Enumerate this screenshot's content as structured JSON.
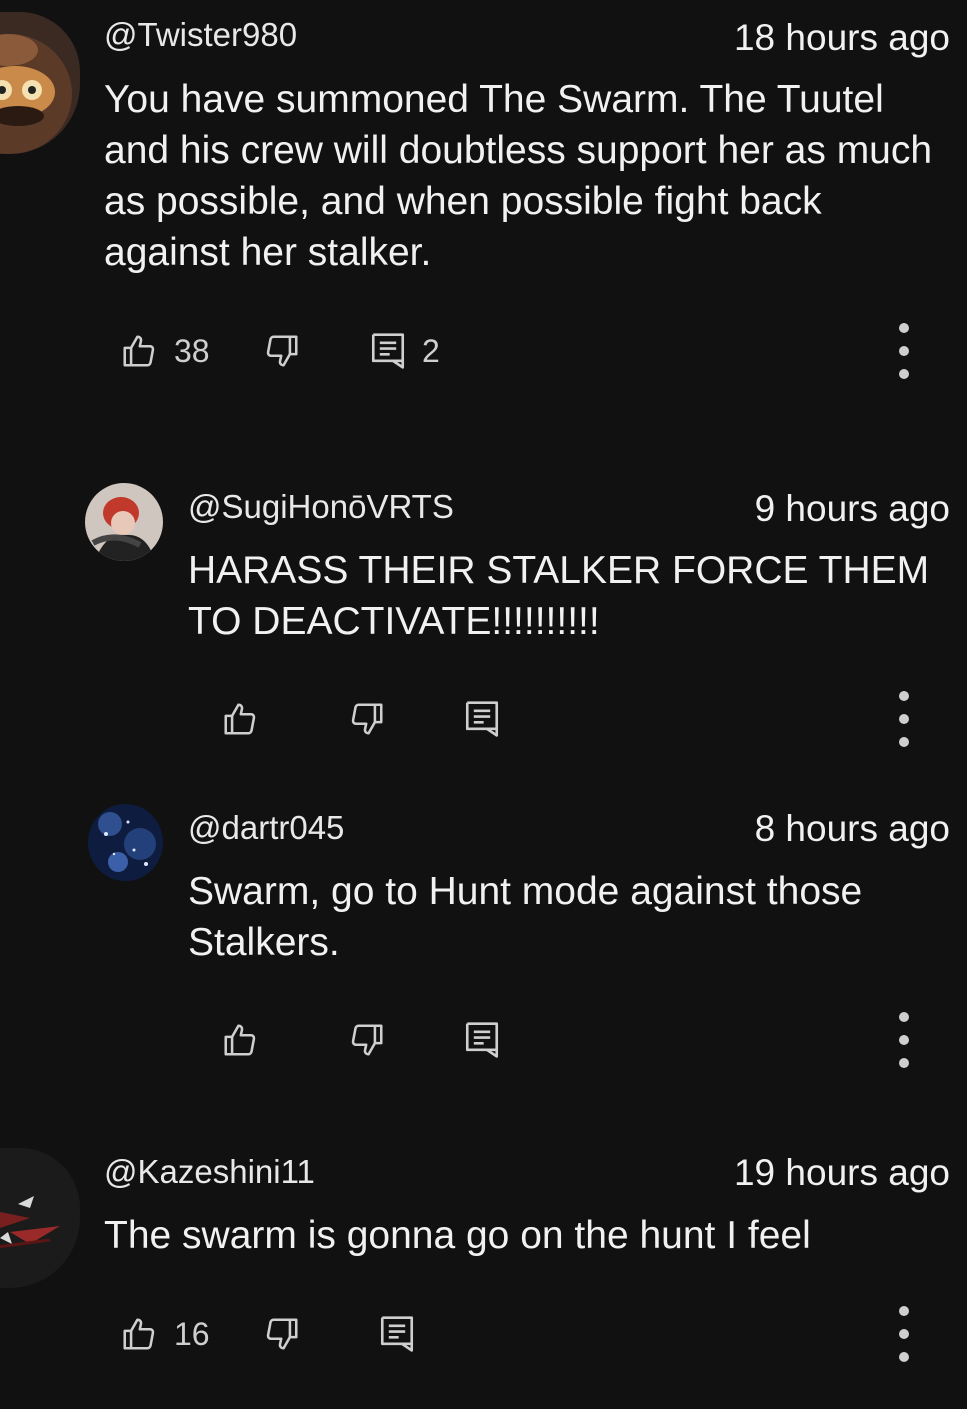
{
  "comments": [
    {
      "handle": "@Twister980",
      "time": "18 hours ago",
      "text": "You have summoned The Swarm. The Tuutel and his crew will doubtless support her as much as possible, and when possible fight back against her stalker.",
      "likes": "38",
      "replies": "2"
    },
    {
      "handle": "@SugiHonōVRTS",
      "time": "9 hours ago",
      "text": "HARASS THEIR STALKER FORCE THEM TO DEACTIVATE!!!!!!!!!!"
    },
    {
      "handle": "@dartr045",
      "time": "8 hours ago",
      "text": "Swarm, go to Hunt mode against those Stalkers."
    },
    {
      "handle": "@Kazeshini11",
      "time": "19 hours ago",
      "text": "The swarm is gonna go on the hunt I feel",
      "likes": "16"
    }
  ],
  "colors": {
    "background": "#111111",
    "text": "#f1f1f1",
    "icon": "#cfcfcf"
  },
  "icons": [
    "thumbs-up-icon",
    "thumbs-down-icon",
    "reply-icon",
    "more-vert-icon"
  ]
}
